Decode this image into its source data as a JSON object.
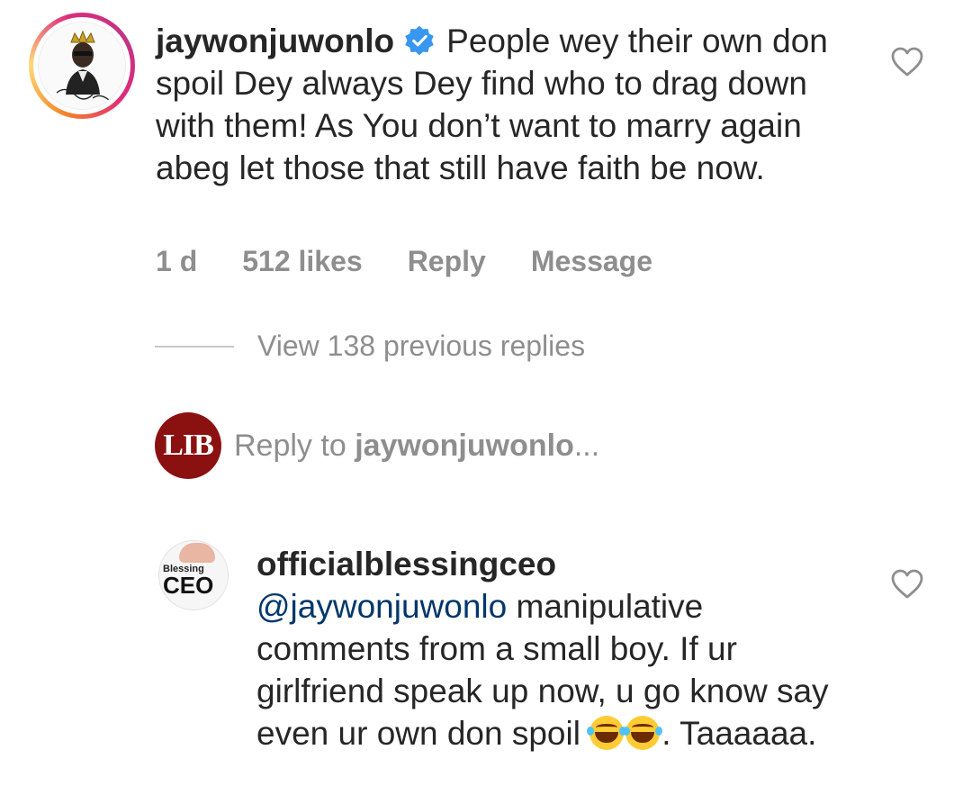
{
  "comment1": {
    "username": "jaywonjuwonlo",
    "verified": true,
    "text": "People wey their own don spoil Dey always Dey find who to drag down with them! As You don’t want to marry again abeg let those that still have faith be now.",
    "age": "1 d",
    "likes": "512 likes",
    "reply_label": "Reply",
    "message_label": "Message"
  },
  "view_replies": "View 138 previous replies",
  "reply_box": {
    "avatar_text": "LIB",
    "prefix": "Reply to ",
    "target": "jaywonjuwonlo",
    "suffix": "..."
  },
  "comment2": {
    "username": "officialblessingceo",
    "avatar_small": "Blessing",
    "avatar_big": "CEO",
    "mention": "@jaywonjuwonlo",
    "text_before_emoji": " manipulative comments from a small boy.  If ur girlfriend speak up now, u go know say even ur own don spoil ",
    "text_after_emoji": ". Taaaaaa.",
    "emoji": "face-with-tears-of-joy"
  },
  "colors": {
    "text": "#262626",
    "secondary": "#8e8e8e",
    "verified_blue": "#3897f0",
    "mention": "#00376b",
    "lib_red": "#8b1111"
  }
}
